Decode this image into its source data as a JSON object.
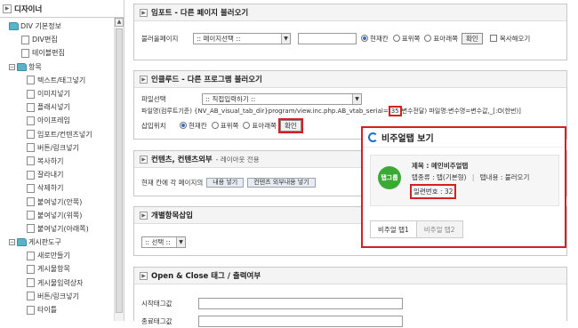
{
  "sidebar": {
    "title": "디자이너",
    "items": [
      {
        "label": "DIV 기본정보",
        "type": "folder",
        "indent": 0
      },
      {
        "label": "DIV편집",
        "type": "file",
        "indent": 1
      },
      {
        "label": "테이블편집",
        "type": "file",
        "indent": 1
      },
      {
        "label": "항목",
        "type": "folder-open",
        "indent": 0
      },
      {
        "label": "텍스트/태그넣기",
        "type": "file",
        "indent": 2
      },
      {
        "label": "이미지넣기",
        "type": "file",
        "indent": 2
      },
      {
        "label": "플래시넣기",
        "type": "file",
        "indent": 2
      },
      {
        "label": "아이프레임",
        "type": "file",
        "indent": 2
      },
      {
        "label": "임포트/컨텐츠넣기",
        "type": "file",
        "indent": 2
      },
      {
        "label": "버튼/링크넣기",
        "type": "file",
        "indent": 2
      },
      {
        "label": "복사하기",
        "type": "file",
        "indent": 2
      },
      {
        "label": "잘라내기",
        "type": "file",
        "indent": 2
      },
      {
        "label": "삭제하기",
        "type": "file",
        "indent": 2
      },
      {
        "label": "붙여넣기(안쪽)",
        "type": "file",
        "indent": 2
      },
      {
        "label": "붙여넣기(위쪽)",
        "type": "file",
        "indent": 2
      },
      {
        "label": "붙여넣기(아래쪽)",
        "type": "file",
        "indent": 2
      },
      {
        "label": "게시판도구",
        "type": "folder-open",
        "indent": 0
      },
      {
        "label": "새로만들기",
        "type": "file",
        "indent": 2
      },
      {
        "label": "게시물항목",
        "type": "file",
        "indent": 2
      },
      {
        "label": "게시물입력상자",
        "type": "file",
        "indent": 2
      },
      {
        "label": "버튼/링크넣기",
        "type": "file",
        "indent": 2
      },
      {
        "label": "타이틀",
        "type": "file",
        "indent": 2
      }
    ]
  },
  "import_panel": {
    "title": "임포트 - 다른 페이지 불러오기",
    "label": "불러올페이지",
    "select_value": ":: 페이지선택 ::",
    "radios": [
      "현재칸",
      "표위쪽",
      "표아래쪽"
    ],
    "confirm": "확인",
    "checkbox": "복사해오기"
  },
  "include_panel": {
    "title": "인클루드 - 다른 프로그램 불러오기",
    "file_label": "파일선택",
    "file_select": ":: 직접입력하기 ::",
    "path_label": "파일명(컴루트기준)",
    "path_value": "{NV_AB_visual_tab_dir}program/view.inc.php.AB_vtab_serial=",
    "serial": "35",
    "var_hint": "변수전달) 파일명:변수명=변수값,_[:O(한번)]",
    "insert_label": "삽입위치",
    "radios": [
      "현재칸",
      "표위쪽",
      "표아래쪽"
    ],
    "confirm": "확인"
  },
  "contents_panel": {
    "title": "컨텐츠, 컨텐츠외부",
    "subtitle": "- 레이아웃 전용",
    "text": "현재 칸에 각 페이지의",
    "btn1": "내용 넣기",
    "btn2": "컨텐츠 외부내용 넣기"
  },
  "individual_panel": {
    "title": "개별항목삽입",
    "select": ":: 선택 ::"
  },
  "openclose_panel": {
    "title": "Open & Close 태그 / 출력여부",
    "label1": "시작태그값",
    "label2": "종료태그값"
  },
  "popup": {
    "title": "비주얼탭 보기",
    "tag_badge": "탭그룹",
    "name": "제목 : 메인비주얼탭",
    "type": "탭종류 : 탭(기본형)",
    "content": "탭내용 : 불러오기",
    "serial": "일련번호 : 32",
    "tabs": [
      "비주얼 탭1",
      "비주얼 탭2"
    ]
  }
}
